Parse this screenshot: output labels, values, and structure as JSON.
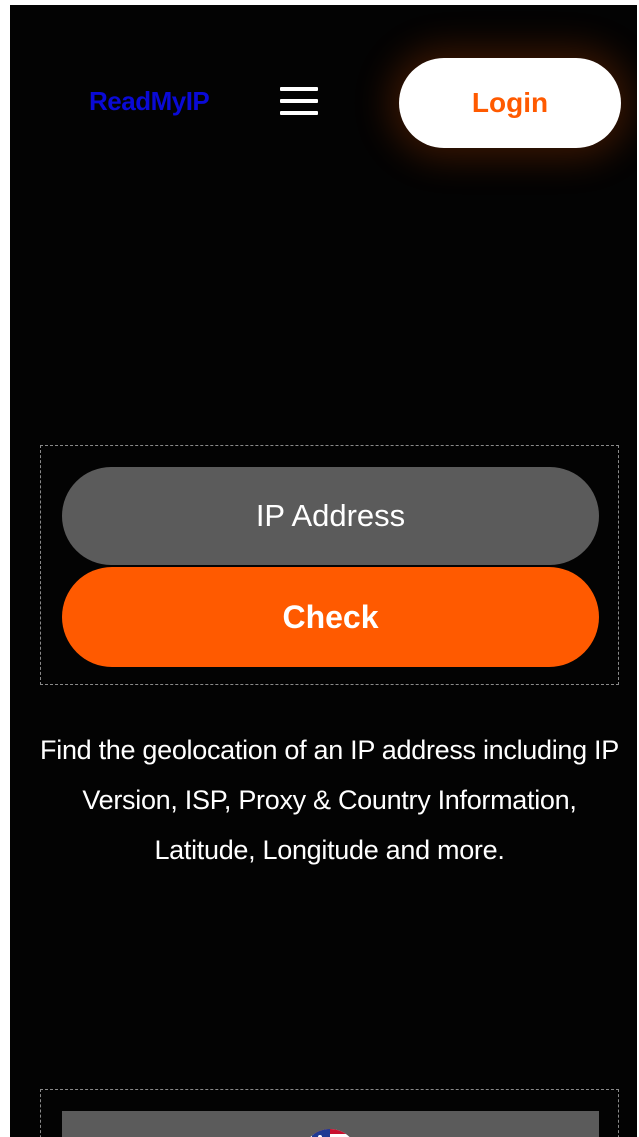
{
  "header": {
    "brand": "ReadMyIP",
    "menu_icon": "hamburger-menu-icon",
    "login_label": "Login"
  },
  "form": {
    "ip_placeholder": "IP Address",
    "ip_value": "",
    "check_label": "Check"
  },
  "description": "Find the geolocation of an IP address including IP Version, ISP, Proxy & Country Information, Latitude, Longitude and more.",
  "result_panel": {
    "icon": "us-flag-icon"
  },
  "colors": {
    "background": "#030303",
    "brand": "#0a0ad6",
    "accent": "#ff5a00",
    "input_bg": "#5b5b5b",
    "text": "#ffffff"
  }
}
